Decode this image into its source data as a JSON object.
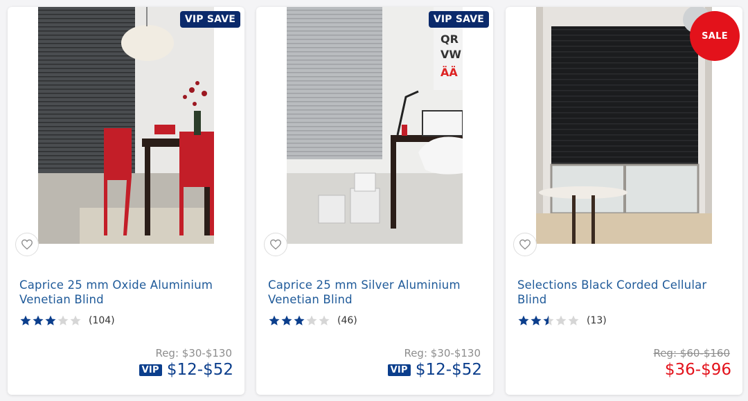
{
  "products": [
    {
      "badge": "VIP SAVE",
      "title_line1": "Caprice 25 mm Oxide Aluminium",
      "title_line2": "Venetian Blind",
      "rating": 3,
      "review_count": "(104)",
      "reg_price": "Reg: $30-$130",
      "vip_label": "VIP",
      "price": "$12-$52"
    },
    {
      "badge": "VIP SAVE",
      "title_line1": "Caprice 25 mm Silver Aluminium",
      "title_line2": "Venetian Blind",
      "rating": 3,
      "review_count": "(46)",
      "reg_price": "Reg: $30-$130",
      "vip_label": "VIP",
      "price": "$12-$52"
    },
    {
      "badge": "SALE",
      "title_line1": "Selections Black Corded Cellular",
      "title_line2": "Blind",
      "rating": 2.5,
      "review_count": "(13)",
      "reg_price": "Reg: $60-$160",
      "price": "$36-$96"
    }
  ],
  "icons": {
    "wishlist": "heart-outline-icon",
    "rating": "star-icon"
  },
  "colors": {
    "title_blue": "#1f5a99",
    "vip_navy": "#0b2a6b",
    "price_blue": "#0b3e8c",
    "sale_red": "#e3121b",
    "star_filled": "#0b3e8c",
    "star_empty": "#d6d6d6"
  }
}
